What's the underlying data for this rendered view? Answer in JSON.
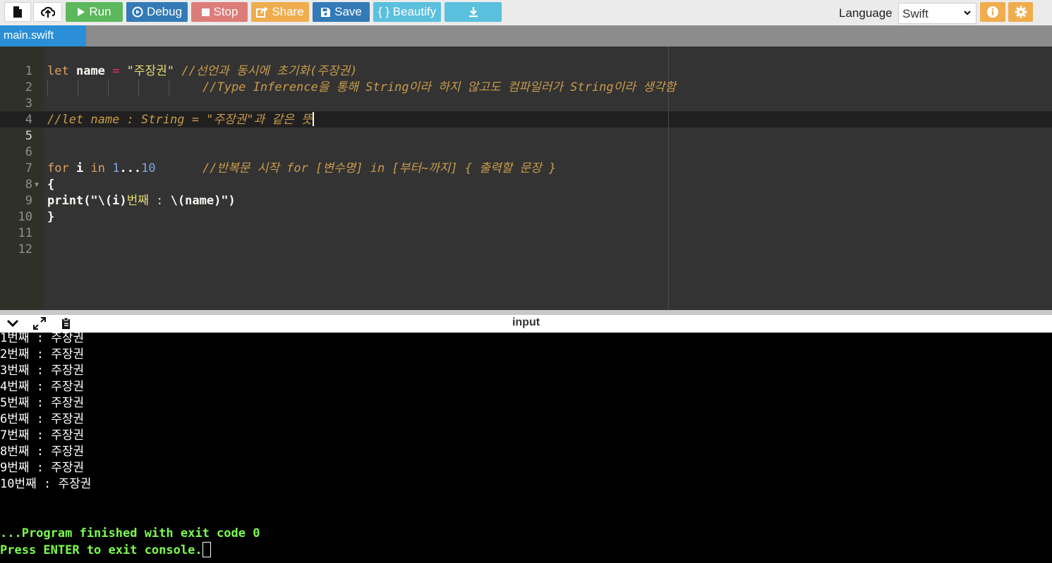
{
  "toolbar": {
    "run_label": "Run",
    "debug_label": "Debug",
    "stop_label": "Stop",
    "share_label": "Share",
    "save_label": "Save",
    "beautify_label": "{ } Beautify",
    "language_label": "Language",
    "language_value": "Swift"
  },
  "tabs": [
    {
      "label": "main.swift"
    }
  ],
  "editor": {
    "line_numbers": [
      "1",
      "2",
      "3",
      "4",
      "5",
      "6",
      "7",
      "8",
      "9",
      "10",
      "11",
      "12"
    ],
    "line2": {
      "kw": "let",
      "name": "name",
      "eq": " = ",
      "str": "\"주장권\"",
      "comment": "//선언과 동시에 초기화(주장권)"
    },
    "line3": {
      "comment": "//Type Inference을 통해 String이라 하지 않고도 컴파일러가 String이라 생각함"
    },
    "line5": {
      "comment": "//let name : String = \"주장권\"과 같은 뜻"
    },
    "line8": {
      "kw_for": "for",
      "var": "i",
      "kw_in": "in",
      "start": "1",
      "range_op": "...",
      "end": "10",
      "comment": "//반복문 시작 for [변수명] in [부터~까지] { 출력할 문장 }"
    },
    "line9": {
      "text": "{"
    },
    "line10": {
      "fn": "print",
      "p1": "(\"\\(",
      "i": "i",
      "p2": ")",
      "lit": "번째 : ",
      "p3": "\\(",
      "name": "name",
      "p4": ")\")"
    },
    "line11": {
      "text": "}"
    }
  },
  "console": {
    "title": "input",
    "output_lines": [
      "1번째 : 주장권",
      "2번째 : 주장권",
      "3번째 : 주장권",
      "4번째 : 주장권",
      "5번째 : 주장권",
      "6번째 : 주장권",
      "7번째 : 주장권",
      "8번째 : 주장권",
      "9번째 : 주장권",
      "10번째 : 주장권"
    ],
    "finished_message": "...Program finished with exit code 0",
    "exit_prompt": "Press ENTER to exit console."
  },
  "colors": {
    "run": "#5cb85c",
    "debug": "#337ab7",
    "stop": "#d9534f",
    "share": "#f0ad4e",
    "beautify": "#5bc0de",
    "tab_active": "#2a8fd6",
    "editor_bg": "#333333",
    "console_green": "#7cfc4c"
  },
  "icons": [
    "new-file-icon",
    "upload-icon",
    "play-icon",
    "debug-icon",
    "stop-icon",
    "share-icon",
    "save-icon",
    "download-icon",
    "info-icon",
    "gear-icon",
    "collapse-icon",
    "expand-icon",
    "copy-icon"
  ]
}
